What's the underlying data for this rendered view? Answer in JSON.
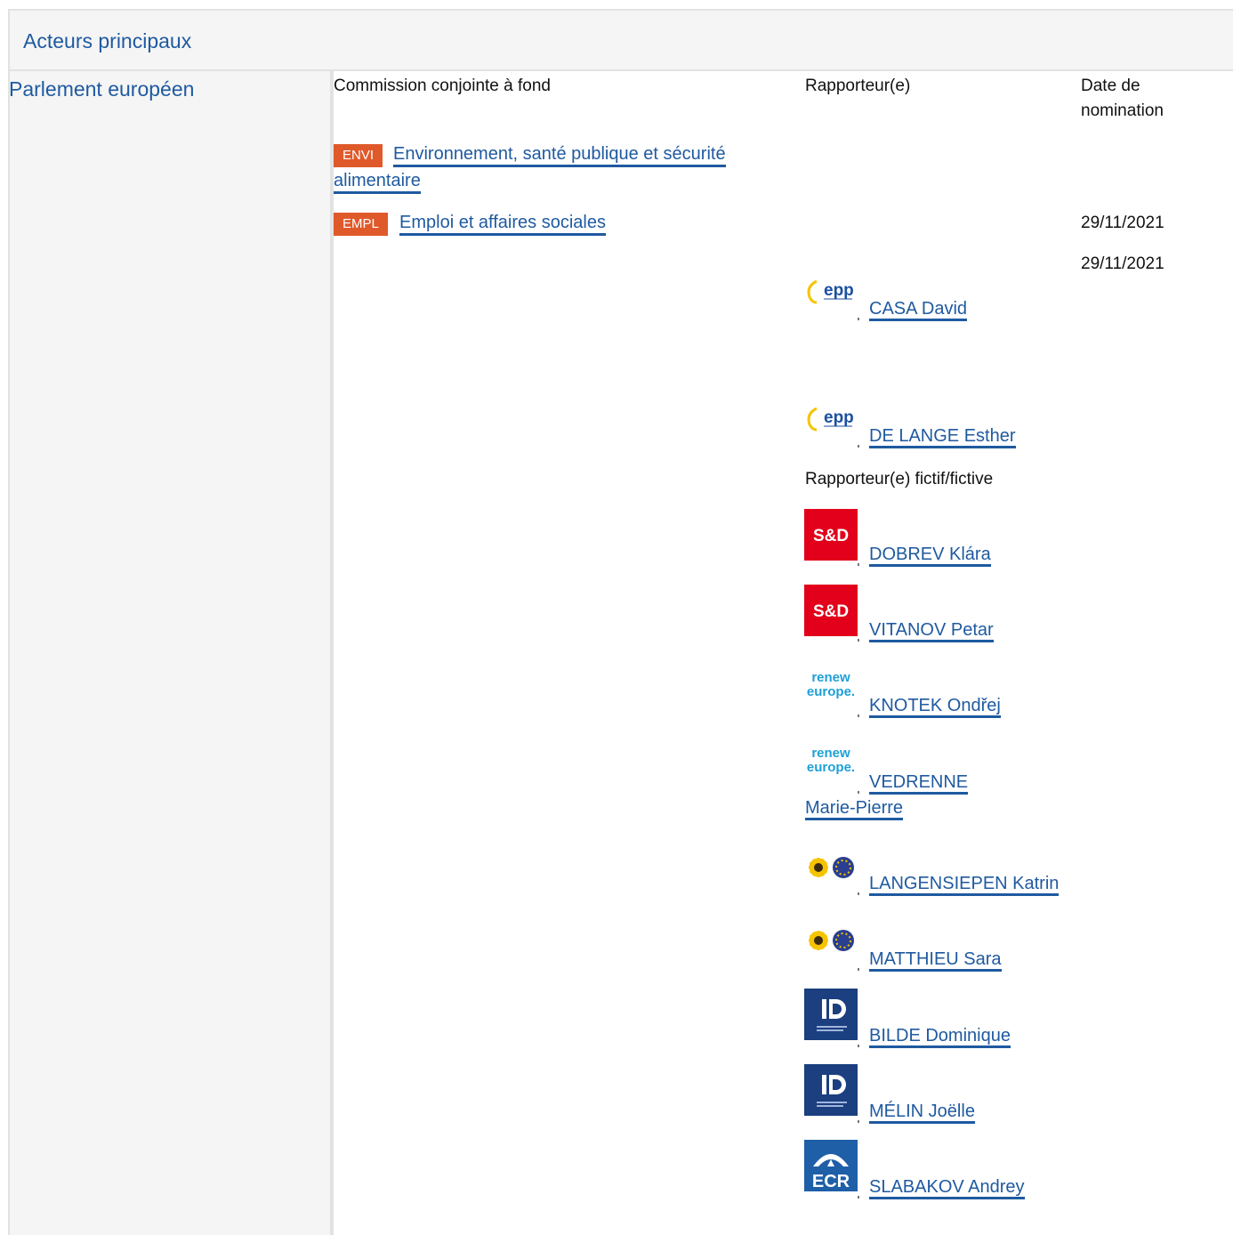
{
  "section": {
    "title": "Acteurs principaux",
    "institution": "Parlement européen"
  },
  "headers": {
    "committee": "Commission conjointe à fond",
    "rapporteur": "Rapporteur(e)",
    "date": "Date de nomination"
  },
  "committees": [
    {
      "code": "ENVI",
      "name": "Environnement, santé publique et sécurité alimentaire",
      "date": ""
    },
    {
      "code": "EMPL",
      "name": "Emploi et affaires sociales",
      "date": "29/11/2021"
    }
  ],
  "rapporteurs_date": "29/11/2021",
  "rapporteurs": [
    {
      "name": "CASA David",
      "group_icon": "epp-logo-icon"
    },
    {
      "name": "DE LANGE Esther",
      "group_icon": "epp-logo-icon"
    }
  ],
  "shadow_heading": "Rapporteur(e) fictif/fictive",
  "shadows": [
    {
      "name": "DOBREV Klára",
      "group_icon": "sd-logo-icon"
    },
    {
      "name": "VITANOV Petar",
      "group_icon": "sd-logo-icon"
    },
    {
      "name": "KNOTEK Ondřej",
      "group_icon": "renew-europe-logo-icon"
    },
    {
      "name": "VEDRENNE Marie-Pierre",
      "group_icon": "renew-europe-logo-icon"
    },
    {
      "name": "LANGENSIEPEN Katrin",
      "group_icon": "greens-efa-logo-icon"
    },
    {
      "name": "MATTHIEU Sara",
      "group_icon": "greens-efa-logo-icon"
    },
    {
      "name": "BILDE Dominique",
      "group_icon": "id-logo-icon"
    },
    {
      "name": "MÉLIN Joëlle",
      "group_icon": "id-logo-icon"
    },
    {
      "name": "SLABAKOV Andrey",
      "group_icon": "ecr-logo-icon"
    }
  ],
  "logo_text": {
    "epp": "epp",
    "sd": "S&D",
    "renew_1": "renew",
    "renew_2": "europe.",
    "ecr": "ECR"
  },
  "colors": {
    "link": "#1f5aa0",
    "badge": "#e0592a",
    "sd": "#e2001a",
    "id": "#1b3f7f",
    "ecr": "#1e5fa8",
    "renew": "#1ea0d8"
  }
}
